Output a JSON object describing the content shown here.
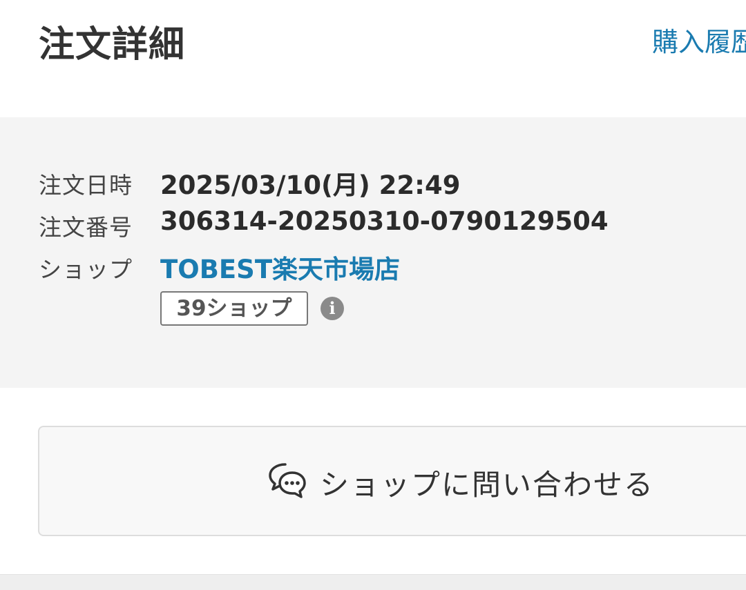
{
  "header": {
    "title": "注文詳細",
    "history_link": "購入履歴"
  },
  "order": {
    "date_label": "注文日時",
    "date_value": "2025/03/10(月) 22:49",
    "number_label": "注文番号",
    "number_value": "306314-20250310-0790129504",
    "shop_label": "ショップ",
    "shop_name": "TOBEST楽天市場店",
    "badge": "39ショップ",
    "info_icon_text": "i"
  },
  "contact": {
    "label": "ショップに問い合わせる",
    "icon": "chat-bubbles-icon"
  },
  "colors": {
    "link": "#1a7bb0",
    "panel_bg": "#f4f4f4",
    "text": "#333333"
  }
}
